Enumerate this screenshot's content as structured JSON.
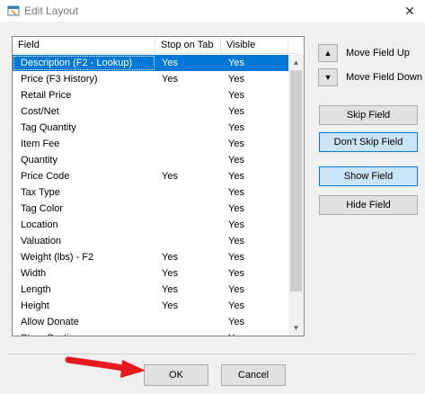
{
  "window": {
    "title": "Edit Layout",
    "close_glyph": "✕"
  },
  "list": {
    "columns": [
      "Field",
      "Stop on Tab",
      "Visible"
    ],
    "rows": [
      {
        "field": "Description (F2 - Lookup)",
        "stop": "Yes",
        "visible": "Yes",
        "selected": true
      },
      {
        "field": "Price (F3 History)",
        "stop": "Yes",
        "visible": "Yes"
      },
      {
        "field": "Retail Price",
        "stop": "",
        "visible": "Yes"
      },
      {
        "field": "Cost/Net",
        "stop": "",
        "visible": "Yes"
      },
      {
        "field": "Tag Quantity",
        "stop": "",
        "visible": "Yes"
      },
      {
        "field": "Item Fee",
        "stop": "",
        "visible": "Yes"
      },
      {
        "field": "Quantity",
        "stop": "",
        "visible": "Yes"
      },
      {
        "field": "Price Code",
        "stop": "Yes",
        "visible": "Yes"
      },
      {
        "field": "Tax Type",
        "stop": "",
        "visible": "Yes"
      },
      {
        "field": "Tag Color",
        "stop": "",
        "visible": "Yes"
      },
      {
        "field": "Location",
        "stop": "",
        "visible": "Yes"
      },
      {
        "field": "Valuation",
        "stop": "",
        "visible": "Yes"
      },
      {
        "field": "Weight (lbs) - F2",
        "stop": "Yes",
        "visible": "Yes"
      },
      {
        "field": "Width",
        "stop": "Yes",
        "visible": "Yes"
      },
      {
        "field": "Length",
        "stop": "Yes",
        "visible": "Yes"
      },
      {
        "field": "Height",
        "stop": "Yes",
        "visible": "Yes"
      },
      {
        "field": "Allow Donate",
        "stop": "",
        "visible": "Yes"
      },
      {
        "field": "Store Section",
        "stop": "",
        "visible": "Yes"
      }
    ]
  },
  "side": {
    "move_up": "Move Field Up",
    "move_down": "Move Field Down",
    "skip": "Skip Field",
    "dont_skip": "Don't Skip Field",
    "show": "Show Field",
    "hide": "Hide Field"
  },
  "footer": {
    "ok": "OK",
    "cancel": "Cancel"
  },
  "colors": {
    "selection": "#0078d7",
    "highlight_button": "#cce4f7",
    "annotation_arrow": "#e8191f"
  }
}
